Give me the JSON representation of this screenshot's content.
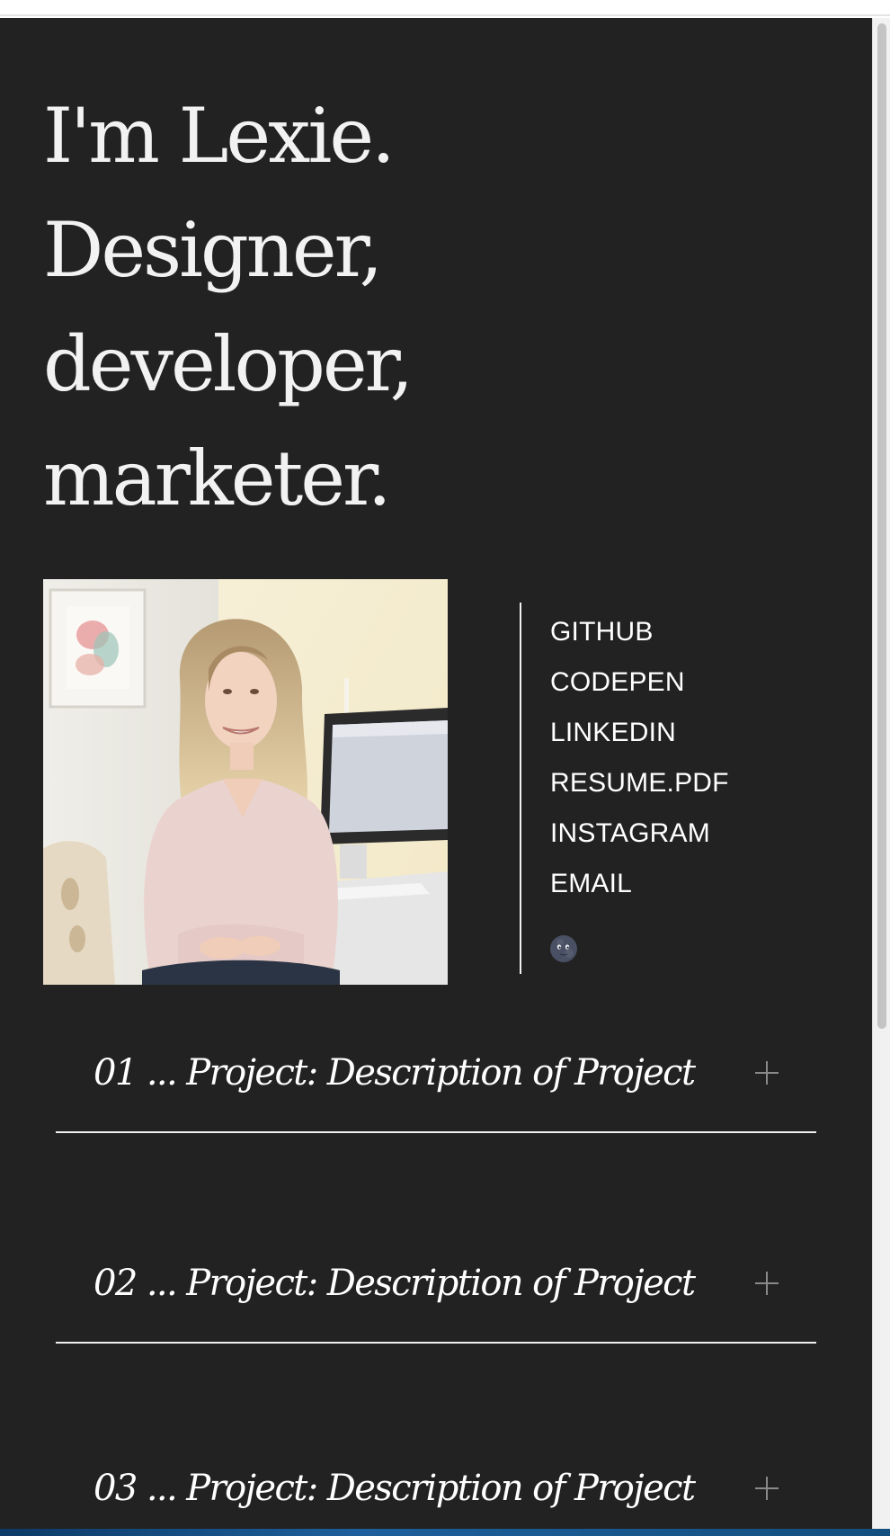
{
  "hero": {
    "line1": "I'm Lexie.",
    "line2": "Designer,",
    "line3": "developer,",
    "line4": "marketer."
  },
  "links": [
    "GITHUB",
    "CODEPEN",
    "LINKEDIN",
    "RESUME.PDF",
    "INSTAGRAM",
    "EMAIL"
  ],
  "theme_toggle": {
    "icon": "new-moon-face-icon"
  },
  "projects": [
    {
      "label": "01 ... Project: Description of Project",
      "icon": "plus-icon"
    },
    {
      "label": "02 ... Project: Description of Project",
      "icon": "plus-icon"
    },
    {
      "label": "03 ... Project: Description of Project",
      "icon": "plus-icon"
    }
  ],
  "colors": {
    "background": "#222222",
    "text": "#f2f2f2",
    "divider": "#f0f0f0",
    "icon_muted": "#8a8a8a"
  }
}
